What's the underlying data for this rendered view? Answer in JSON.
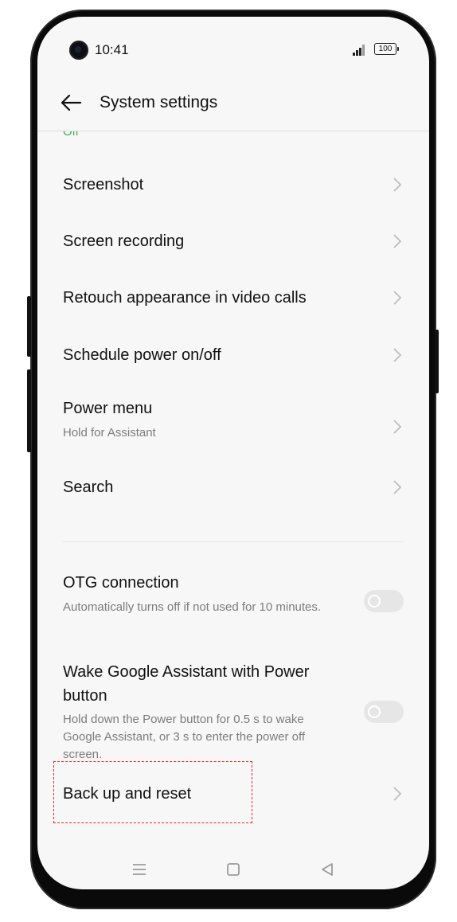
{
  "status_bar": {
    "time": "10:41",
    "battery": "100"
  },
  "app_bar": {
    "title": "System settings"
  },
  "partial_status": "Off",
  "items": [
    {
      "title": "Screenshot"
    },
    {
      "title": "Screen recording"
    },
    {
      "title": "Retouch appearance in video calls"
    },
    {
      "title": "Schedule power on/off"
    },
    {
      "title": "Power menu",
      "subtitle": "Hold for Assistant"
    },
    {
      "title": "Search"
    },
    {
      "title": "OTG connection",
      "subtitle": "Automatically turns off if not used for 10 minutes.",
      "toggle": "off"
    },
    {
      "title": "Wake Google Assistant with Power button",
      "subtitle": "Hold down the Power button for 0.5 s to wake Google Assistant, or 3 s to enter the power off screen.",
      "toggle": "off"
    },
    {
      "title": "Back up and reset",
      "highlighted": true
    }
  ],
  "nav_bar": {
    "icons": [
      "menu-icon",
      "home-square-icon",
      "back-triangle-icon"
    ]
  },
  "colors": {
    "accent_green": "#2fae5a",
    "highlight_red": "#e12a2a",
    "screen_bg": "#f7f7f7"
  }
}
